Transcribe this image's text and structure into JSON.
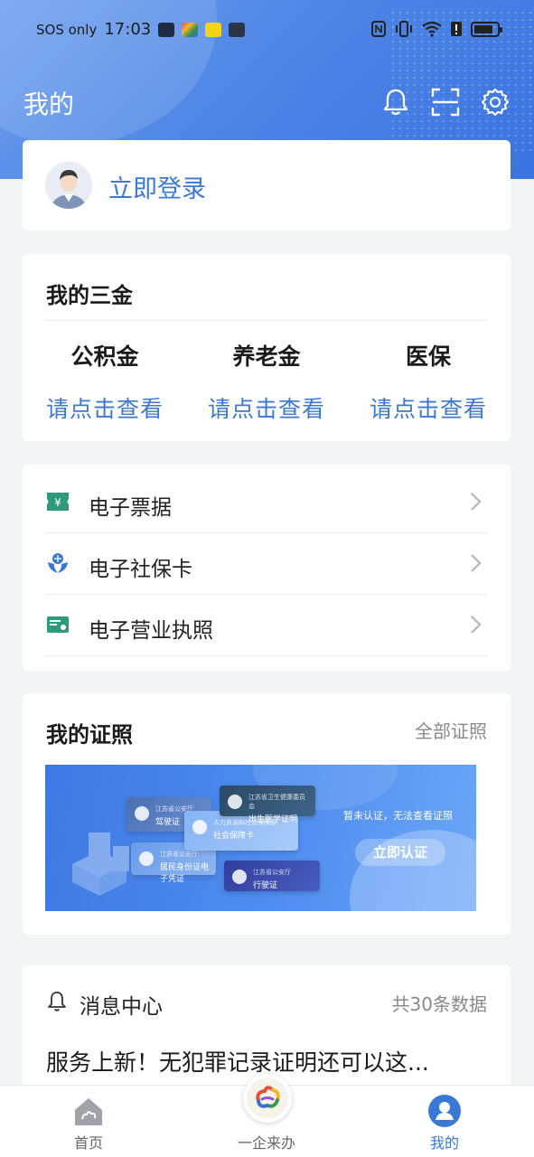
{
  "status_bar": {
    "carrier": "SOS only",
    "time": "17:03"
  },
  "header": {
    "title": "我的"
  },
  "login": {
    "label": "立即登录"
  },
  "sanjin": {
    "title": "我的三金",
    "items": [
      {
        "label": "公积金",
        "link": "请点击查看"
      },
      {
        "label": "养老金",
        "link": "请点击查看"
      },
      {
        "label": "医保",
        "link": "请点击查看"
      }
    ]
  },
  "services": {
    "items": [
      {
        "label": "电子票据",
        "icon": "ticket-icon"
      },
      {
        "label": "电子社保卡",
        "icon": "social-security-icon"
      },
      {
        "label": "电子营业执照",
        "icon": "business-license-icon"
      }
    ]
  },
  "certificates": {
    "title": "我的证照",
    "more": "全部证照",
    "banner": {
      "cards": [
        {
          "top": "江苏省公安厅",
          "name": "驾驶证"
        },
        {
          "top": "江苏省公安厅",
          "name": "居民身份证电子凭证"
        },
        {
          "top": "人力资源和社会保障部",
          "name": "社会保障卡"
        },
        {
          "top": "江苏省卫生健康委员会",
          "name": "出生医学证明"
        },
        {
          "top": "江苏省公安厅",
          "name": "行驶证"
        }
      ],
      "note": "暂未认证，无法查看证照",
      "button": "立即认证"
    }
  },
  "messages": {
    "title": "消息中心",
    "count": "共30条数据",
    "latest": "服务上新！无犯罪记录证明还可以这..."
  },
  "tabbar": {
    "tabs": [
      {
        "label": "首页"
      },
      {
        "label": "一企来办"
      },
      {
        "label": "我的"
      }
    ]
  },
  "colors": {
    "accent": "#3a78d6",
    "header_gradient_start": "#6fa0ef",
    "header_gradient_end": "#3b74e0"
  }
}
